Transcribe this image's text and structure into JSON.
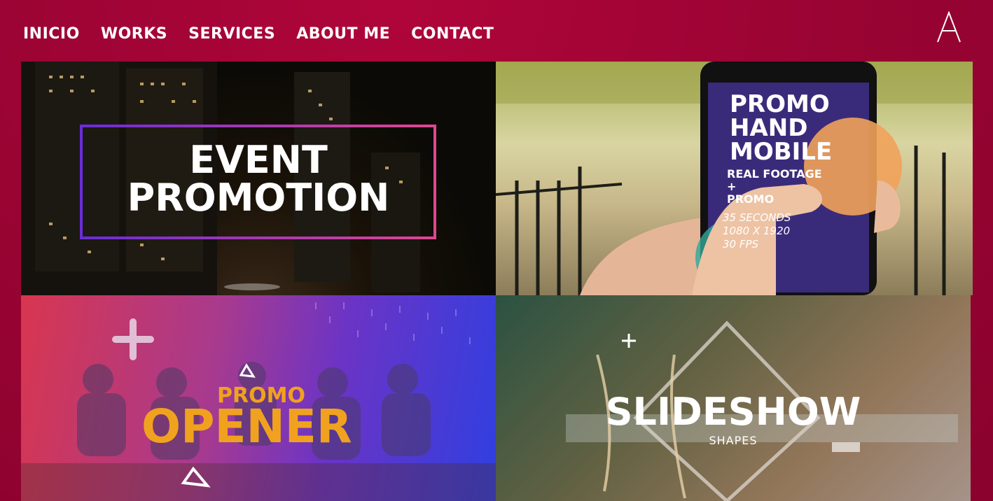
{
  "nav": {
    "items": [
      "INICIO",
      "WORKS",
      "SERVICES",
      "ABOUT ME",
      "CONTACT"
    ]
  },
  "brand": {
    "logo_letter": "A"
  },
  "works": [
    {
      "lines": [
        "EVENT",
        "PROMOTION"
      ]
    },
    {
      "lines": [
        "PROMO",
        "HAND",
        "MOBILE"
      ],
      "sub": [
        "REAL FOOTAGE",
        "+",
        "PROMO"
      ],
      "specs": [
        "35 SECONDS",
        "1080 X 1920",
        "30 FPS"
      ]
    },
    {
      "lines": [
        "PROMO",
        "OPENER"
      ]
    },
    {
      "lines": [
        "SLIDESHOW"
      ],
      "sub": [
        "SHAPES"
      ]
    }
  ],
  "colors": {
    "accent": "#a0033a",
    "tile1_frame_start": "#6a2cd9",
    "tile1_frame_end": "#e1468f",
    "opener_gold": "#f0a21f"
  }
}
